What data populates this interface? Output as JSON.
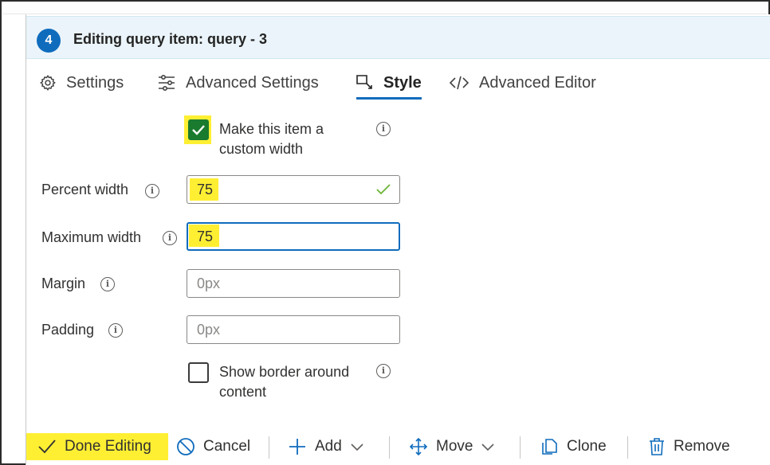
{
  "header": {
    "step_number": "4",
    "title": "Editing query item: query - 3"
  },
  "tabs": [
    {
      "label": "Settings",
      "icon": "gear-icon"
    },
    {
      "label": "Advanced Settings",
      "icon": "sliders-icon"
    },
    {
      "label": "Style",
      "icon": "style-icon",
      "active": true
    },
    {
      "label": "Advanced Editor",
      "icon": "code-icon"
    }
  ],
  "form": {
    "custom_width": {
      "label_line1": "Make this item a",
      "label_line2": "custom width",
      "checked": true
    },
    "percent_width": {
      "label": "Percent width",
      "value": "75",
      "valid": true
    },
    "maximum_width": {
      "label": "Maximum width",
      "value": "75",
      "focused": true
    },
    "margin": {
      "label": "Margin",
      "placeholder": "0px"
    },
    "padding": {
      "label": "Padding",
      "placeholder": "0px"
    },
    "show_border": {
      "label_line1": "Show border around",
      "label_line2": "content",
      "checked": false
    }
  },
  "toolbar": {
    "done_label": "Done Editing",
    "cancel_label": "Cancel",
    "add_label": "Add",
    "move_label": "Move",
    "clone_label": "Clone",
    "remove_label": "Remove"
  },
  "colors": {
    "accent": "#0f6cbd",
    "highlight": "#ffef33",
    "checked_green": "#1a7a2e",
    "header_bg": "#eaf4fa"
  }
}
